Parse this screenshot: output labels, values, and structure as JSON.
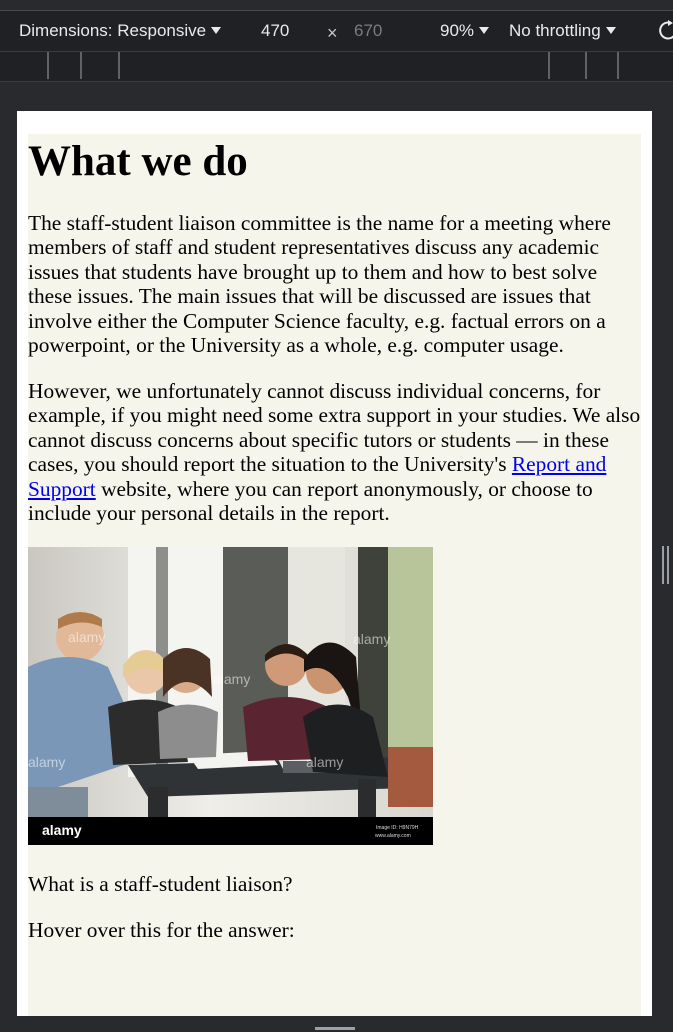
{
  "devtools": {
    "dimensions_label": "Dimensions: Responsive",
    "width_value": "470",
    "times_symbol": "×",
    "height_value": "670",
    "zoom": "90%",
    "throttling": "No throttling",
    "icons": [
      "dropdown-caret-icon",
      "rotate-icon"
    ]
  },
  "page": {
    "heading": "What we do",
    "para1": "The staff-student liaison committee is the name for a meeting where members of staff and student representatives discuss any academic issues that students have brought up to them and how to best solve these issues. The main issues that will be discussed are issues that involve either the Computer Science faculty, e.g. factual errors on a powerpoint, or the University as a whole, e.g. computer usage.",
    "para2_before": "However, we unfortunately cannot discuss individual concerns, for example, if you might need some extra support in your studies. We also cannot discuss concerns about specific tutors or students — in these cases, you should report the situation to the University's ",
    "para2_link": "Report and Support",
    "para2_after": " website, where you can report anonymously, or choose to include your personal details in the report.",
    "image": {
      "watermark": "alamy",
      "image_id": "Image ID: H9N79H",
      "site": "www.alamy.com"
    },
    "question": "What is a staff-student liaison?",
    "hover_prompt": "Hover over this for the answer:"
  },
  "colors": {
    "devtools_bg": "#202124",
    "frame_bg": "#292a2d",
    "page_bg": "#f6f5ec",
    "link": "#0000ee"
  }
}
